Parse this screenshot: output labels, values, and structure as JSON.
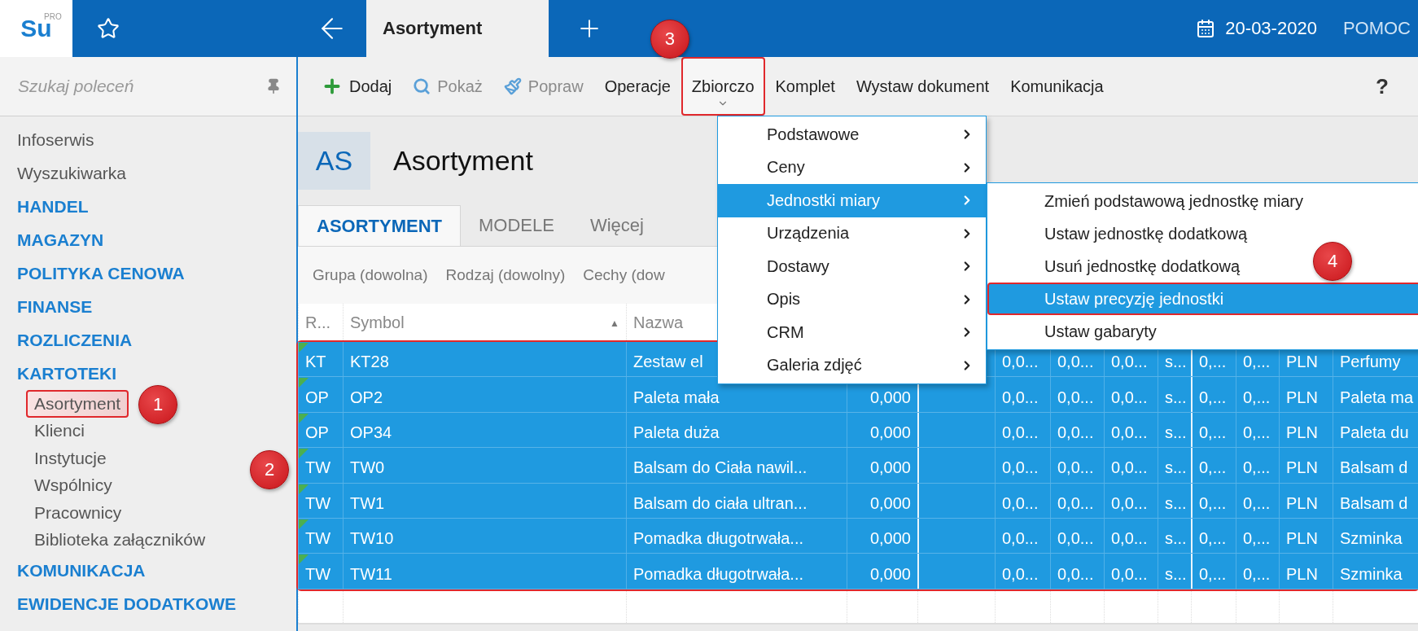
{
  "top_bar": {
    "logo": {
      "text": "Su",
      "badge": "PRO"
    },
    "tabs": [
      {
        "label": "Asortyment",
        "selected": true
      }
    ],
    "date": "20-03-2020",
    "help": "POMOC"
  },
  "sidebar": {
    "search": {
      "placeholder": "Szukaj poleceń"
    },
    "items": [
      {
        "kind": "link",
        "label": "Infoserwis",
        "selected": false
      },
      {
        "kind": "link",
        "label": "Wyszukiwarka",
        "selected": false
      },
      {
        "kind": "section",
        "label": "HANDEL",
        "selected": false
      },
      {
        "kind": "section",
        "label": "MAGAZYN",
        "selected": false
      },
      {
        "kind": "section",
        "label": "POLITYKA CENOWA",
        "selected": false
      },
      {
        "kind": "section",
        "label": "FINANSE",
        "selected": false
      },
      {
        "kind": "section",
        "label": "ROZLICZENIA",
        "selected": false
      },
      {
        "kind": "section",
        "label": "KARTOTEKI",
        "selected": false,
        "children": [
          {
            "kind": "link",
            "label": "Asortyment",
            "selected": true,
            "callout": "1"
          },
          {
            "kind": "link",
            "label": "Klienci",
            "selected": false
          },
          {
            "kind": "link",
            "label": "Instytucje",
            "selected": false
          },
          {
            "kind": "link",
            "label": "Wspólnicy",
            "selected": false
          },
          {
            "kind": "link",
            "label": "Pracownicy",
            "selected": false
          },
          {
            "kind": "link",
            "label": "Biblioteka załączników",
            "selected": false
          }
        ]
      },
      {
        "kind": "section",
        "label": "KOMUNIKACJA",
        "selected": false
      },
      {
        "kind": "section",
        "label": "EWIDENCJE DODATKOWE",
        "selected": false
      }
    ]
  },
  "toolbar": {
    "items": [
      {
        "kind": "add",
        "label": "Dodaj",
        "disabled": false
      },
      {
        "kind": "view",
        "label": "Pokaż",
        "disabled": true
      },
      {
        "kind": "edit",
        "label": "Popraw",
        "disabled": true
      },
      {
        "kind": "text",
        "label": "Operacje",
        "disabled": false
      },
      {
        "kind": "dropdown",
        "label": "Zbiorczo",
        "disabled": false,
        "callout": "3"
      },
      {
        "kind": "text",
        "label": "Komplet",
        "disabled": false
      },
      {
        "kind": "text",
        "label": "Wystaw dokument",
        "disabled": false
      },
      {
        "kind": "text",
        "label": "Komunikacja",
        "disabled": false
      }
    ],
    "help": "?"
  },
  "header": {
    "badge": "AS",
    "title": "Asortyment"
  },
  "tabs": [
    {
      "label": "ASORTYMENT",
      "selected": true
    },
    {
      "label": "MODELE",
      "selected": false
    },
    {
      "label": "Więcej",
      "selected": false
    }
  ],
  "filters": [
    "Grupa (dowolna)",
    "Rodzaj (dowolny)",
    "Cechy (dow"
  ],
  "table": {
    "columns": [
      {
        "label": "R..."
      },
      {
        "label": "Symbol",
        "sort_mark": "▲"
      },
      {
        "label": "Nazwa"
      }
    ],
    "callout": "2",
    "rows": [
      {
        "selected": true,
        "r": "KT",
        "symbol": "KT28",
        "name": "Zestaw el",
        "cells": [
          "0,0...",
          "0,0...",
          "0,0...",
          "s...",
          "0,...",
          "0,...",
          "PLN",
          "Perfumy"
        ]
      },
      {
        "selected": true,
        "r": "OP",
        "symbol": "OP2",
        "name": "Paleta mała",
        "value": "0,000",
        "cells": [
          "0,0...",
          "0,0...",
          "0,0...",
          "s...",
          "0,...",
          "0,...",
          "PLN",
          "Paleta ma"
        ]
      },
      {
        "selected": true,
        "r": "OP",
        "symbol": "OP34",
        "name": "Paleta duża",
        "value": "0,000",
        "cells": [
          "0,0...",
          "0,0...",
          "0,0...",
          "s...",
          "0,...",
          "0,...",
          "PLN",
          "Paleta du"
        ]
      },
      {
        "selected": true,
        "r": "TW",
        "symbol": "TW0",
        "name": "Balsam do Ciała nawil...",
        "value": "0,000",
        "cells": [
          "0,0...",
          "0,0...",
          "0,0...",
          "s...",
          "0,...",
          "0,...",
          "PLN",
          "Balsam d"
        ]
      },
      {
        "selected": true,
        "r": "TW",
        "symbol": "TW1",
        "name": "Balsam do ciała ultran...",
        "value": "0,000",
        "cells": [
          "0,0...",
          "0,0...",
          "0,0...",
          "s...",
          "0,...",
          "0,...",
          "PLN",
          "Balsam d"
        ]
      },
      {
        "selected": true,
        "r": "TW",
        "symbol": "TW10",
        "name": "Pomadka długotrwała...",
        "value": "0,000",
        "cells": [
          "0,0...",
          "0,0...",
          "0,0...",
          "s...",
          "0,...",
          "0,...",
          "PLN",
          "Szminka"
        ]
      },
      {
        "selected": true,
        "r": "TW",
        "symbol": "TW11",
        "name": "Pomadka długotrwała...",
        "value": "0,000",
        "cells": [
          "0,0...",
          "0,0...",
          "0,0...",
          "s...",
          "0,...",
          "0,...",
          "PLN",
          "Szminka"
        ]
      }
    ]
  },
  "menu": {
    "items": [
      {
        "label": "Podstawowe",
        "selected": false
      },
      {
        "label": "Ceny",
        "selected": false
      },
      {
        "label": "Jednostki miary",
        "selected": true
      },
      {
        "label": "Urządzenia",
        "selected": false
      },
      {
        "label": "Dostawy",
        "selected": false
      },
      {
        "label": "Opis",
        "selected": false
      },
      {
        "label": "CRM",
        "selected": false
      },
      {
        "label": "Galeria zdjęć",
        "selected": false
      }
    ],
    "submenu": [
      {
        "label": "Zmień podstawową jednostkę miary",
        "selected": false
      },
      {
        "label": "Ustaw jednostkę dodatkową",
        "selected": false
      },
      {
        "label": "Usuń jednostkę dodatkową",
        "selected": false
      },
      {
        "label": "Ustaw precyzję jednostki",
        "selected": true,
        "callout": "4"
      },
      {
        "label": "Ustaw gabaryty",
        "selected": false
      }
    ]
  }
}
